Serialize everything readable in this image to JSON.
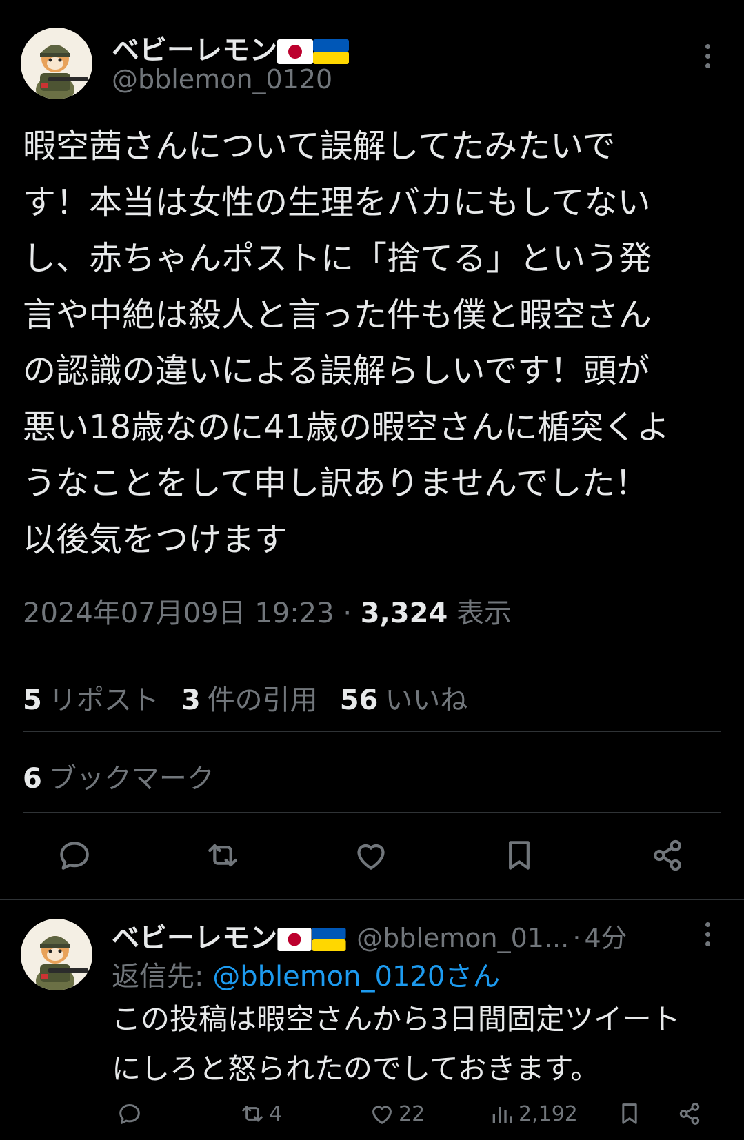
{
  "tweet": {
    "author_name": "ベビーレモン",
    "author_handle": "@bblemon_0120",
    "text": "暇空茜さんについて誤解してたみたいで\nす！本当は女性の生理をバカにもしてない\nし、赤ちゃんポストに「捨てる」という発\n言や中絶は殺人と言った件も僕と暇空さん\nの認識の違いによる誤解らしいです！頭が\n悪い18歳なのに41歳の暇空さんに楯突くよ\nうなことをして申し訳ありませんでした！\n以後気をつけます",
    "datetime": "2024年07月09日 19:23",
    "separator": "·",
    "views_count": "3,324",
    "views_label": "表示",
    "reposts_count": "5",
    "reposts_label": "リポスト",
    "quotes_count": "3",
    "quotes_label": "件の引用",
    "likes_count": "56",
    "likes_label": "いいね",
    "bookmarks_count": "6",
    "bookmarks_label": "ブックマーク"
  },
  "reply": {
    "author_name": "ベビーレモン",
    "author_handle": "@bblemon_01...",
    "separator": "·",
    "time": "4分",
    "reply_to_label": "返信先:",
    "reply_to_mention": "@bblemon_0120さん",
    "text": "この投稿は暇空さんから3日間固定ツイート\nにしろと怒られたのでしておきます。",
    "retweets": "4",
    "likes": "22",
    "views": "2,192"
  },
  "icons": [
    "more-icon",
    "reply-icon",
    "retweet-icon",
    "like-icon",
    "bookmark-icon",
    "share-icon",
    "views-icon",
    "japan-flag-icon",
    "ukraine-flag-icon"
  ],
  "colors": {
    "background": "#000000",
    "text": "#e7e9ea",
    "muted": "#71767b",
    "link": "#1d9bf0",
    "divider": "#2f3336"
  }
}
